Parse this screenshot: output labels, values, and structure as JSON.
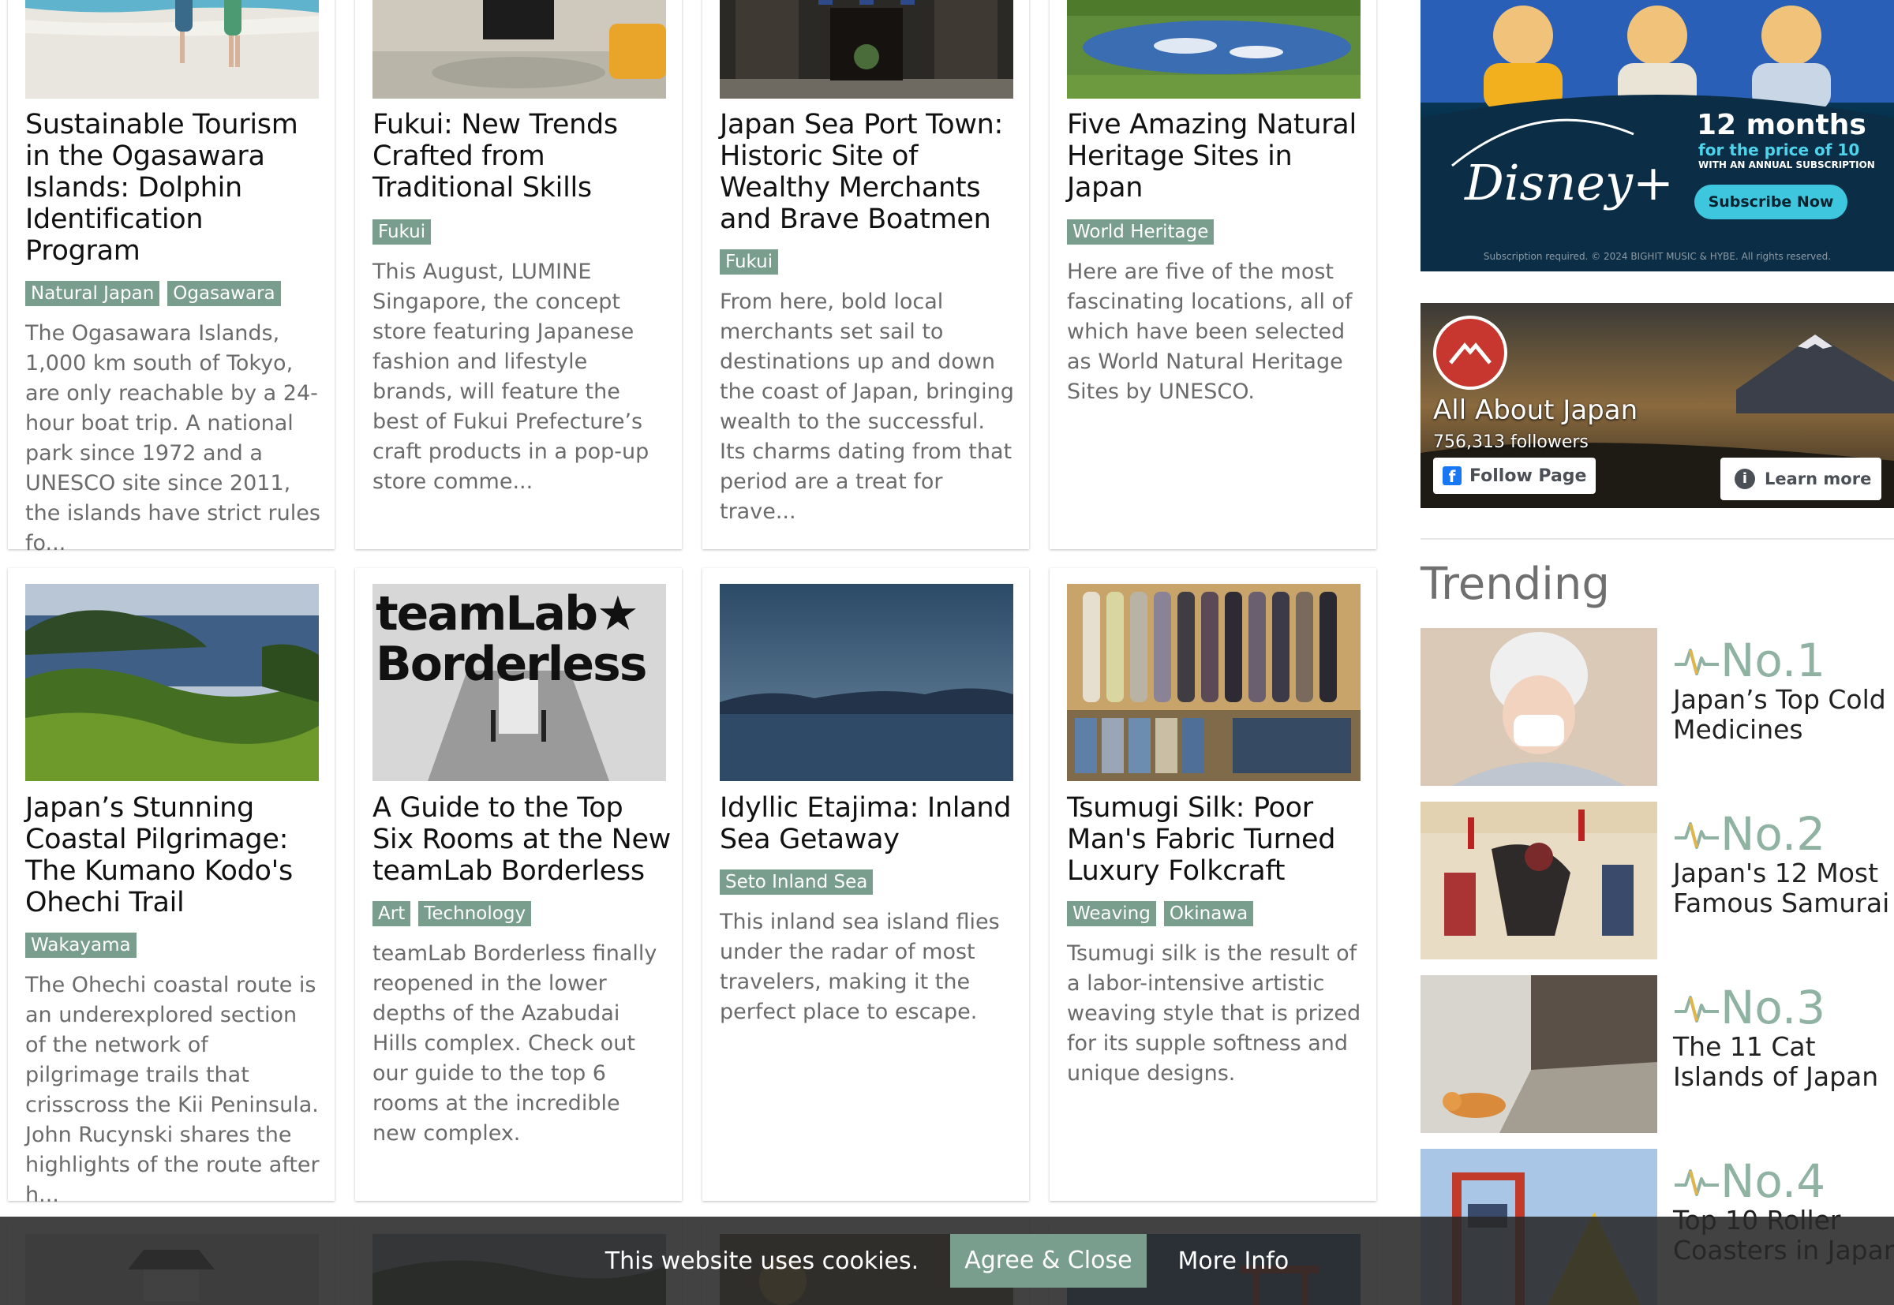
{
  "articles": [
    {
      "title": "Sustainable Tourism in the Ogasawara Islands: Dolphin Identification Program",
      "tags": [
        "Natural Japan",
        "Ogasawara"
      ],
      "description": "The Ogasawara Islands, 1,000 km south of Tokyo, are only reachable by a 24-hour boat trip. A national park since 1972 and a UNESCO site since 2011, the islands have strict rules fo..."
    },
    {
      "title": "Fukui: New Trends Crafted from Traditional Skills",
      "tags": [
        "Fukui"
      ],
      "description": "This August, LUMINE Singapore, the concept store featuring Japanese fashion and lifestyle brands, will feature the best of Fukui Prefecture’s craft products in a pop-up store comme..."
    },
    {
      "title": "Japan Sea Port Town: Historic Site of Wealthy Merchants and Brave Boatmen",
      "tags": [
        "Fukui"
      ],
      "description": "From here, bold local merchants set sail to destinations up and down the coast of Japan, bringing wealth to the successful. Its charms dating from that period are a treat for trave..."
    },
    {
      "title": "Five Amazing Natural Heritage Sites in Japan",
      "tags": [
        "World Heritage"
      ],
      "description": "Here are five of the most fascinating locations, all of which have been selected as World Natural Heritage Sites by UNESCO."
    },
    {
      "title": "Japan’s Stunning Coastal Pilgrimage: The Kumano Kodo's Ohechi Trail",
      "tags": [
        "Wakayama"
      ],
      "description": "The Ohechi coastal route is an underexplored section of the network of pilgrimage trails that crisscross the Kii Peninsula. John Rucynski shares the highlights of the route after h..."
    },
    {
      "title": "A Guide to the Top Six Rooms at the New teamLab Borderless",
      "tags": [
        "Art",
        "Technology"
      ],
      "description": "teamLab Borderless finally reopened in the lower depths of the Azabudai Hills complex. Check out our guide to the top 6 rooms at the incredible new complex.",
      "image_text": "teamLab★ Borderless"
    },
    {
      "title": "Idyllic Etajima: Inland Sea Getaway",
      "tags": [
        "Seto Inland Sea"
      ],
      "description": "This inland sea island flies under the radar of most travelers, making it the perfect place to escape."
    },
    {
      "title": "Tsumugi Silk: Poor Man's Fabric Turned Luxury Folkcraft",
      "tags": [
        "Weaving",
        "Okinawa"
      ],
      "description": "Tsumugi silk is the result of a labor-intensive artistic weaving style that is prized for its supple softness and unique designs."
    }
  ],
  "ad": {
    "brand": "Disney+",
    "headline": "12 months",
    "subline": "for the price of 10",
    "small": "WITH AN ANNUAL SUBSCRIPTION",
    "cta": "Subscribe Now",
    "legal": "Subscription required. © 2024 BIGHIT MUSIC & HYBE. All rights reserved."
  },
  "facebook": {
    "page_name": "All About Japan",
    "followers": "756,313 followers",
    "follow_label": "Follow Page",
    "learn_label": "Learn more"
  },
  "trending": {
    "title": "Trending",
    "items": [
      {
        "rank": "No.1",
        "title": "Japan’s Top Cold Medicines"
      },
      {
        "rank": "No.2",
        "title": "Japan's 12 Most Famous Samurai"
      },
      {
        "rank": "No.3",
        "title": "The 11 Cat Islands of Japan"
      },
      {
        "rank": "No.4",
        "title": "Top 10 Roller Coasters in Japan"
      }
    ]
  },
  "cookie": {
    "message": "This website uses cookies.",
    "agree_label": "Agree & Close",
    "more_label": "More Info"
  },
  "colors": {
    "tag_bg": "#7a9e8e",
    "rank_color": "#8fb2a3",
    "cookie_bg": "#282828"
  }
}
